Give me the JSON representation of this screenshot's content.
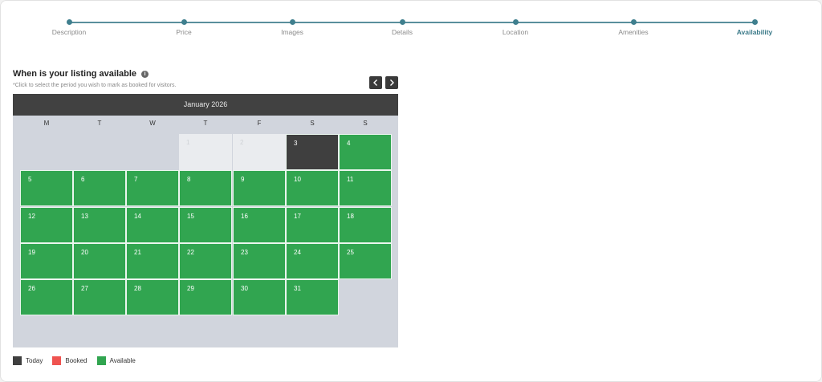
{
  "steps": [
    {
      "label": "Description",
      "active": false
    },
    {
      "label": "Price",
      "active": false
    },
    {
      "label": "Images",
      "active": false
    },
    {
      "label": "Details",
      "active": false
    },
    {
      "label": "Location",
      "active": false
    },
    {
      "label": "Amenities",
      "active": false
    },
    {
      "label": "Availability",
      "active": true
    }
  ],
  "heading": {
    "title": "When is your listing available",
    "info_icon": "i"
  },
  "note": "*Click to select the period you wish to mark as booked for visitors.",
  "calendar": {
    "month_label": "January 2026",
    "weekdays": [
      "M",
      "T",
      "W",
      "T",
      "F",
      "S",
      "S"
    ],
    "days": [
      {
        "day": "1",
        "status": "past"
      },
      {
        "day": "2",
        "status": "past"
      },
      {
        "day": "3",
        "status": "today"
      },
      {
        "day": "4",
        "status": "available"
      },
      {
        "day": "5",
        "status": "available"
      },
      {
        "day": "6",
        "status": "available"
      },
      {
        "day": "7",
        "status": "available"
      },
      {
        "day": "8",
        "status": "available"
      },
      {
        "day": "9",
        "status": "available"
      },
      {
        "day": "10",
        "status": "available"
      },
      {
        "day": "11",
        "status": "available"
      },
      {
        "day": "12",
        "status": "available"
      },
      {
        "day": "13",
        "status": "available"
      },
      {
        "day": "14",
        "status": "available"
      },
      {
        "day": "15",
        "status": "available"
      },
      {
        "day": "16",
        "status": "available"
      },
      {
        "day": "17",
        "status": "available"
      },
      {
        "day": "18",
        "status": "available"
      },
      {
        "day": "19",
        "status": "available"
      },
      {
        "day": "20",
        "status": "available"
      },
      {
        "day": "21",
        "status": "available"
      },
      {
        "day": "22",
        "status": "available"
      },
      {
        "day": "23",
        "status": "available"
      },
      {
        "day": "24",
        "status": "available"
      },
      {
        "day": "25",
        "status": "available"
      },
      {
        "day": "26",
        "status": "available"
      },
      {
        "day": "27",
        "status": "available"
      },
      {
        "day": "28",
        "status": "available"
      },
      {
        "day": "29",
        "status": "available"
      },
      {
        "day": "30",
        "status": "available"
      },
      {
        "day": "31",
        "status": "available"
      }
    ]
  },
  "nav": {
    "prev_icon": "chevron-left-icon",
    "next_icon": "chevron-right-icon"
  },
  "legend": [
    {
      "label": "Today",
      "color": "#3f3f3f"
    },
    {
      "label": "Booked",
      "color": "#ef5350"
    },
    {
      "label": "Available",
      "color": "#31a550"
    }
  ],
  "colors": {
    "accent": "#3b7a89",
    "available": "#31a550",
    "today": "#3f3f3f",
    "booked": "#ef5350",
    "header": "#414141"
  }
}
